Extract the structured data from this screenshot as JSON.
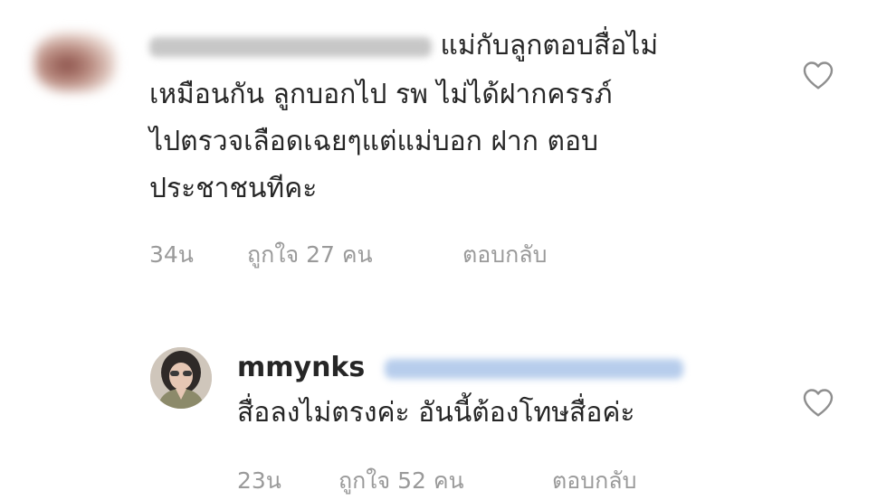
{
  "comments": [
    {
      "lines": [
        "แม่กับลูกตอบสื่อไม่",
        "เหมือนกัน ลูกบอกไป รพ ไม่ได้ฝากครรภ์",
        "ไปตรวจเลือดเฉยๆแต่แม่บอก ฝาก ตอบ",
        "ประชาชนทีคะ"
      ],
      "time": "34น",
      "likes": "ถูกใจ 27 คน",
      "reply": "ตอบกลับ"
    },
    {
      "username": "mmynks",
      "text": "สื่อลงไม่ตรงค่ะ อันนี้ต้องโทษสื่อค่ะ",
      "time": "23น",
      "likes": "ถูกใจ 52 คน",
      "reply": "ตอบกลับ"
    }
  ],
  "icons": {
    "like": "heart-outline-icon",
    "avatar1": "blurred-avatar",
    "avatar2": "profile-photo"
  },
  "colors": {
    "text": "#262626",
    "meta": "#9a9a9a",
    "heart_stroke": "#8e8e8e",
    "mention_blur": "#b7cdec"
  }
}
